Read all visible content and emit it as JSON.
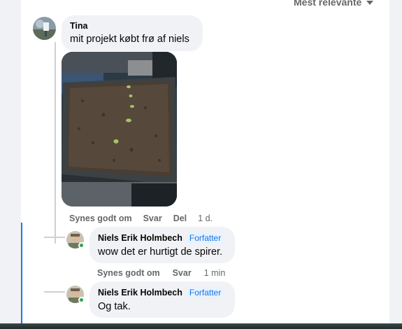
{
  "sort": {
    "label": "Mest relevante"
  },
  "comments": [
    {
      "author": "Tina",
      "text": "mit projekt købt frø af niels",
      "has_photo": true,
      "actions": {
        "like": "Synes godt om",
        "reply": "Svar",
        "share": "Del",
        "time": "1 d."
      },
      "replies": [
        {
          "author": "Niels Erik Holmbech",
          "badge": "Forfatter",
          "text": "wow det er hurtigt de spirer.",
          "actions": {
            "like": "Synes godt om",
            "reply": "Svar",
            "time": "1 min"
          }
        },
        {
          "author": "Niels Erik Holmbech",
          "badge": "Forfatter",
          "text": "Og tak."
        }
      ]
    }
  ],
  "colors": {
    "accent": "#1877f2",
    "bubble": "#f0f2f5",
    "secondary_text": "#65676b",
    "online": "#31a24c"
  }
}
